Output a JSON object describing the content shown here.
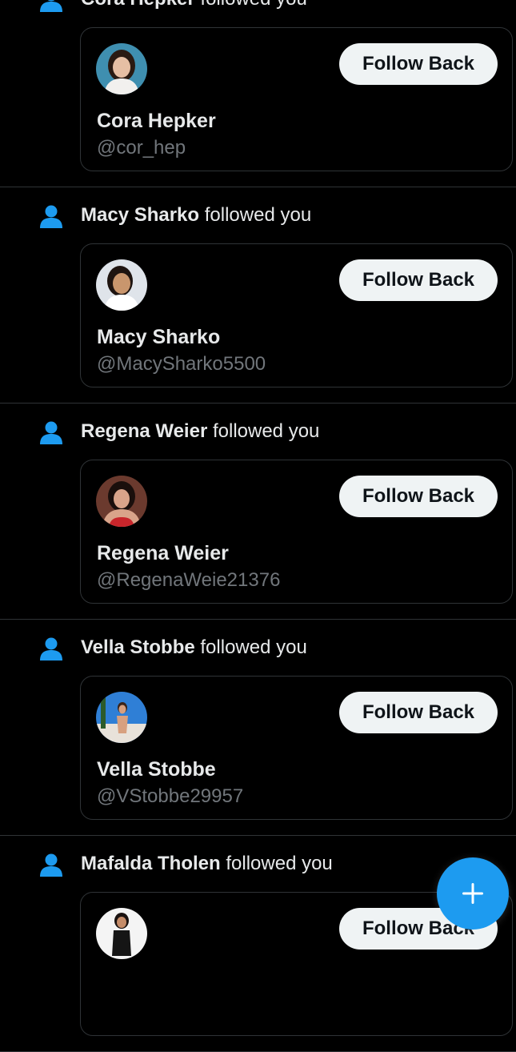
{
  "notifications": [
    {
      "name": "Cora Hepker",
      "action": " followed you",
      "display_name": "Cora Hepker",
      "handle": "@cor_hep",
      "button_label": "Follow Back",
      "avatar": {
        "bg": "#3f8fb0",
        "skin": "#e6bfa4",
        "hair": "#2a1a12",
        "top": "#f2f0ee"
      }
    },
    {
      "name": "Macy Sharko",
      "action": " followed you",
      "display_name": "Macy Sharko",
      "handle": "@MacySharko5500",
      "button_label": "Follow Back",
      "avatar": {
        "bg": "#dfe4ea",
        "skin": "#c9966d",
        "hair": "#1e1410",
        "top": "#ffffff"
      }
    },
    {
      "name": "Regena Weier",
      "action": " followed you",
      "display_name": "Regena Weier",
      "handle": "@RegenaWeie21376",
      "button_label": "Follow Back",
      "avatar": {
        "bg": "#6b3a2e",
        "skin": "#d9a48a",
        "hair": "#1a0f0c",
        "top": "#c8252b"
      }
    },
    {
      "name": "Vella Stobbe",
      "action": " followed you",
      "display_name": "Vella Stobbe",
      "handle": "@VStobbe29957",
      "button_label": "Follow Back",
      "avatar": {
        "bg": "#2f7fd6",
        "skin": "#d7a07f",
        "hair": "#3b2418",
        "top": "#e8e2da"
      }
    },
    {
      "name": "Mafalda Tholen",
      "action": " followed you",
      "display_name": "",
      "handle": "",
      "button_label": "Follow Back",
      "avatar": {
        "bg": "#f4f4f4",
        "skin": "#c58c69",
        "hair": "#1a1210",
        "top": "#151515"
      }
    }
  ],
  "fab": {
    "icon": "plus-icon",
    "label": "+"
  },
  "colors": {
    "accent": "#1d9bf0",
    "background": "#000000",
    "divider": "#2f3336",
    "text_primary": "#e7e9ea",
    "text_secondary": "#71767b",
    "button_bg": "#eff3f4",
    "button_text": "#0f1419"
  },
  "icons": {
    "follow_notification": "person-icon"
  }
}
